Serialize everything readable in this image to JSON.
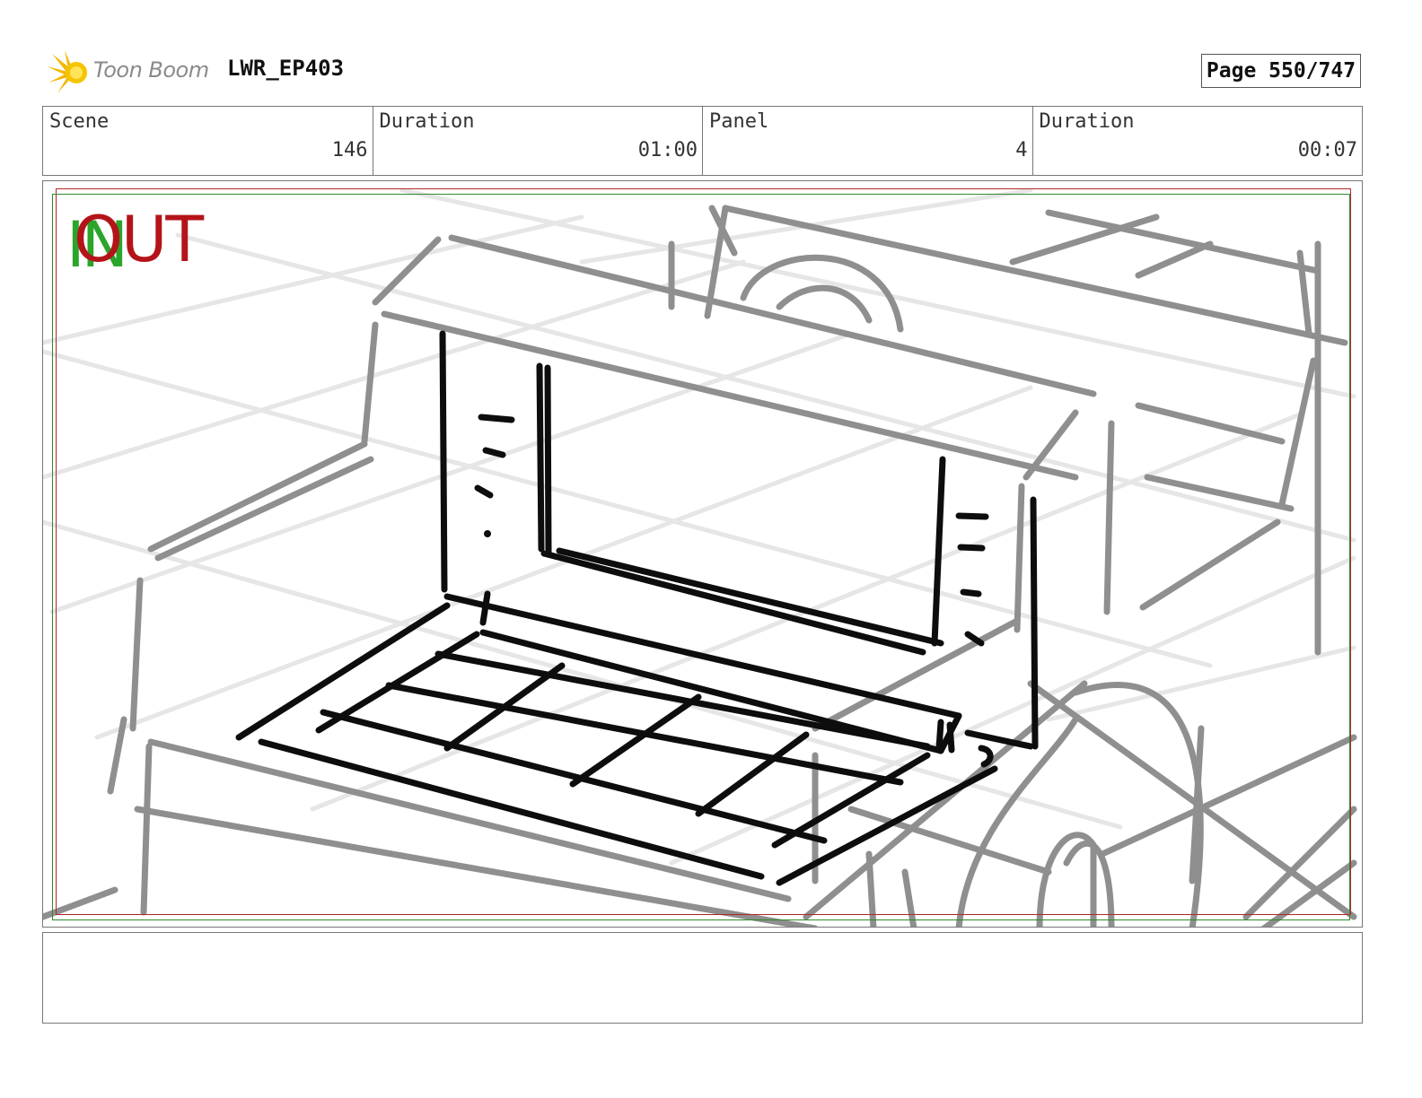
{
  "header": {
    "logo_text": "Toon Boom",
    "logo_icon": "star-burst-icon",
    "project_title": "LWR_EP403",
    "page_label": "Page 550/747"
  },
  "info": {
    "scene_label": "Scene",
    "scene_value": "146",
    "scene_duration_label": "Duration",
    "scene_duration_value": "01:00",
    "panel_label": "Panel",
    "panel_value": "4",
    "panel_duration_label": "Duration",
    "panel_duration_value": "00:07"
  },
  "panel": {
    "in_label": "IN",
    "out_label": "OUT",
    "safe_frame_color": "#b3262b",
    "action_frame_color": "#2e8a2e"
  },
  "notes": {
    "text": ""
  }
}
